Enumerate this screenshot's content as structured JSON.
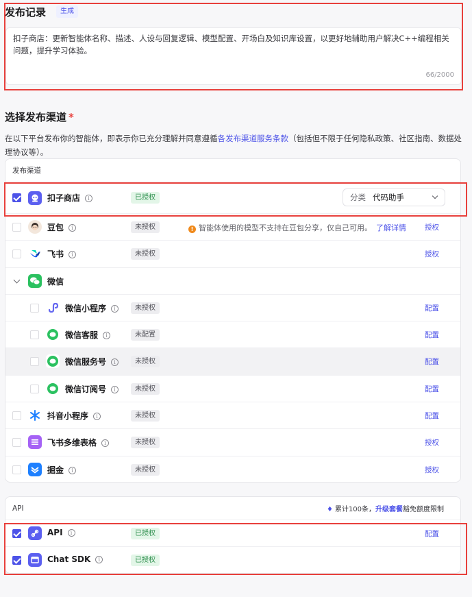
{
  "release": {
    "title": "发布记录",
    "generate_label": "生成",
    "text": "扣子商店：更新智能体名称、描述、人设与回复逻辑、模型配置、开场白及知识库设置，以更好地辅助用户解决C++编程相关问题，提升学习体验。",
    "counter": "66/2000"
  },
  "channels_section": {
    "title": "选择发布渠道",
    "required_mark": "*",
    "desc_prefix": "在以下平台发布你的智能体，即表示你已充分理解并同意遵循",
    "desc_link": "各发布渠道服务条款",
    "desc_suffix": "（包括但不限于任何隐私政策、社区指南、数据处理协议等）。"
  },
  "channel_card": {
    "header": "发布渠道",
    "coze_store": {
      "name": "扣子商店",
      "status": "已授权",
      "category_label": "分类",
      "category_value": "代码助手"
    },
    "doubao": {
      "name": "豆包",
      "status": "未授权",
      "action": "授权",
      "warning": "智能体使用的模型不支持在豆包分享，仅自己可用。",
      "warning_link": "了解详情"
    },
    "feishu": {
      "name": "飞书",
      "status": "未授权",
      "action": "授权"
    },
    "wechat": {
      "name": "微信"
    },
    "wechat_mini": {
      "name": "微信小程序",
      "status": "未授权",
      "action": "配置"
    },
    "wechat_cs": {
      "name": "微信客服",
      "status": "未配置",
      "action": "配置"
    },
    "wechat_service": {
      "name": "微信服务号",
      "status": "未授权",
      "action": "配置"
    },
    "wechat_sub": {
      "name": "微信订阅号",
      "status": "未授权",
      "action": "配置"
    },
    "douyin_mini": {
      "name": "抖音小程序",
      "status": "未授权",
      "action": "配置"
    },
    "feishu_sheet": {
      "name": "飞书多维表格",
      "status": "未授权",
      "action": "授权"
    },
    "juejin": {
      "name": "掘金",
      "status": "未授权",
      "action": "授权"
    }
  },
  "api_card": {
    "header": "API",
    "note_prefix": "累计100条，",
    "note_link": "升级套餐",
    "note_suffix": "豁免额度限制",
    "api": {
      "name": "API",
      "status": "已授权",
      "action": "配置"
    },
    "chat_sdk": {
      "name": "Chat SDK",
      "status": "已授权"
    }
  },
  "colors": {
    "accent": "#4d53e8",
    "highlight_frame": "#e8403c",
    "authorized_bg": "#e3f6e8",
    "authorized_text": "#2f8f4e"
  },
  "icons": [
    "coze-store-icon",
    "doubao-icon",
    "feishu-icon",
    "wechat-icon",
    "wechat-mini-program-icon",
    "wechat-service-icon",
    "douyin-icon",
    "feishu-sheet-icon",
    "juejin-icon",
    "api-icon",
    "chat-sdk-icon",
    "info-icon",
    "warning-icon",
    "chevron-down-icon",
    "diamond-icon"
  ]
}
